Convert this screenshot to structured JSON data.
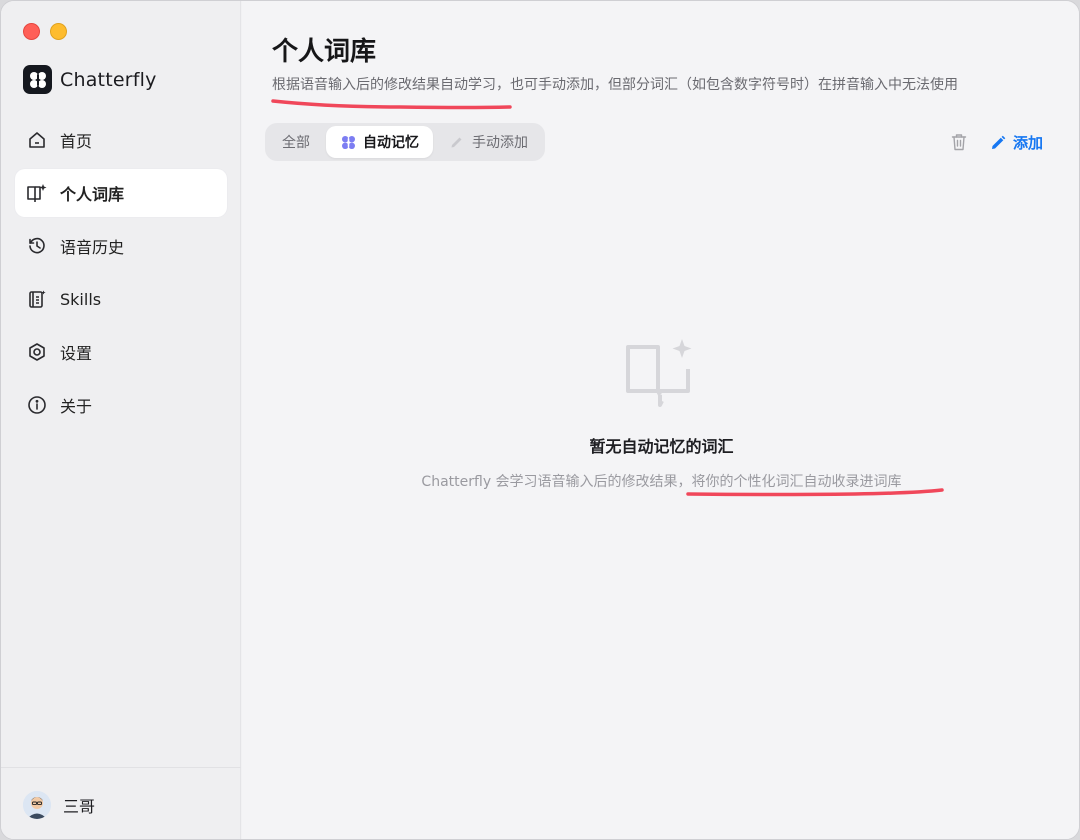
{
  "app": {
    "name": "Chatterfly"
  },
  "sidebar": {
    "items": [
      {
        "label": "首页",
        "icon": "home-icon"
      },
      {
        "label": "个人词库",
        "icon": "book-icon",
        "active": true
      },
      {
        "label": "语音历史",
        "icon": "history-icon"
      },
      {
        "label": "Skills",
        "icon": "skills-icon"
      },
      {
        "label": "设置",
        "icon": "settings-icon"
      },
      {
        "label": "关于",
        "icon": "info-icon"
      }
    ],
    "user": {
      "name": "三哥"
    }
  },
  "main": {
    "title": "个人词库",
    "subtitle": "根据语音输入后的修改结果自动学习，也可手动添加，但部分词汇（如包含数字符号时）在拼音输入中无法使用",
    "tabs": [
      {
        "label": "全部",
        "active": false
      },
      {
        "label": "自动记忆",
        "active": true,
        "icon": "butterfly-icon"
      },
      {
        "label": "手动添加",
        "active": false,
        "icon": "pencil-icon"
      }
    ],
    "add_label": "添加",
    "empty": {
      "title": "暂无自动记忆的词汇",
      "description": "Chatterfly 会学习语音输入后的修改结果，将你的个性化词汇自动收录进词库"
    }
  },
  "colors": {
    "accent": "#1677f2",
    "annotation_red": "#f0475a",
    "butterfly": "#7c7df2"
  }
}
